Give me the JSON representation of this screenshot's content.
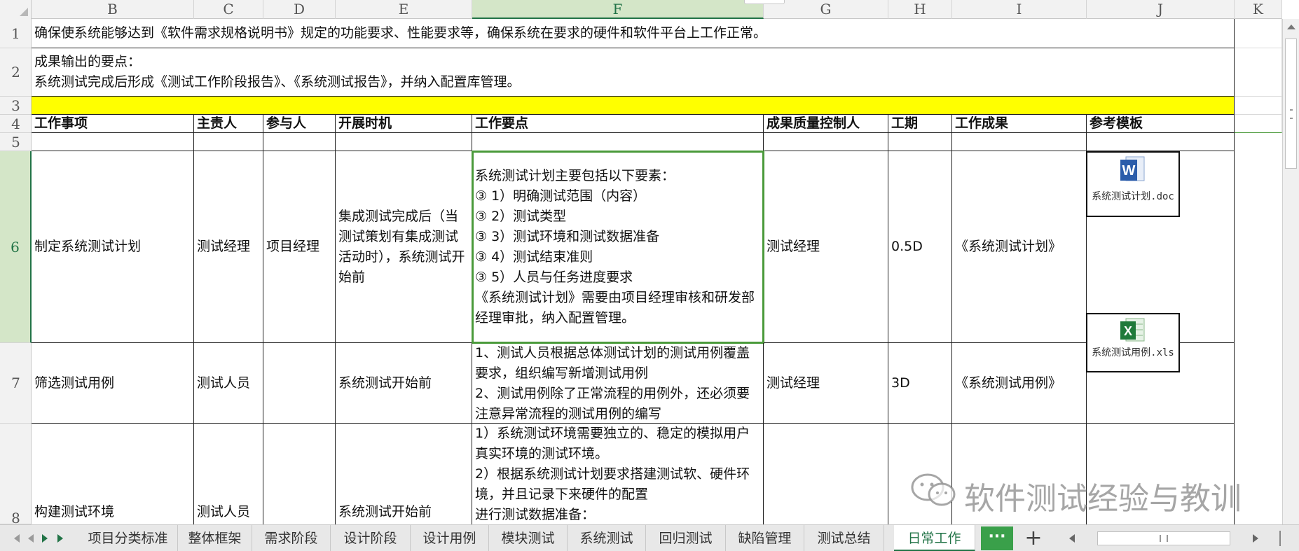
{
  "column_headers": [
    "B",
    "C",
    "D",
    "E",
    "F",
    "G",
    "H",
    "I",
    "J",
    "K"
  ],
  "row_headers": [
    "1",
    "2",
    "3",
    "4",
    "5",
    "6",
    "7",
    "8"
  ],
  "rows": {
    "r1": "确保使系统能够达到《软件需求规格说明书》规定的功能要求、性能要求等，确保系统在要求的硬件和软件平台上工作正常。",
    "r2": "成果输出的要点：\n系统测试完成后形成《测试工作阶段报告》、《系统测试报告》，并纳入配置库管理。"
  },
  "table_headers": [
    "工作事项",
    "主责人",
    "参与人",
    "开展时机",
    "工作要点",
    "成果质量控制人",
    "工期",
    "工作成果",
    "参考模板"
  ],
  "data_rows": [
    {
      "item": "制定系统测试计划",
      "owner": "测试经理",
      "participant": "项目经理",
      "timing": "集成测试完成后（当测试策划有集成测试活动时），系统测试开始前",
      "points": " 系统测试计划主要包括以下要素：\n③ 1）明确测试范围（内容）\n③ 2）测试类型\n③ 3）测试环境和测试数据准备\n③ 4）测试结束准则\n③ 5）人员与任务进度要求\n《系统测试计划》需要由项目经理审核和研发部经理审批，纳入配置管理。",
      "qc": "测试经理",
      "duration": "0.5D",
      "result": "《系统测试计划》",
      "template_file": "系统测试计划.doc"
    },
    {
      "item": "筛选测试用例",
      "owner": "测试人员",
      "participant": "",
      "timing": "系统测试开始前",
      "points": "1、测试人员根据总体测试计划的测试用例覆盖要求，组织编写新增测试用例\n2、测试用例除了正常流程的用例外，还必须要注意异常流程的测试用例的编写",
      "qc": "测试经理",
      "duration": "3D",
      "result": "《系统测试用例》",
      "template_file": "系统测试用例.xls"
    },
    {
      "item": "构建测试环境",
      "owner": "测试人员",
      "participant": "",
      "timing": "系统测试开始前",
      "points": "1）系统测试环境需要独立的、稳定的模拟用户真实环境的测试环境。\n2）根据系统测试计划要求搭建测试软、硬件环境，并且记录下来硬件的配置\n进行测试数据准备：",
      "qc": "",
      "duration": "",
      "result": "",
      "template_file": ""
    }
  ],
  "sheet_tabs": [
    "项目分类标准",
    "整体框架",
    "需求阶段",
    "设计阶段",
    "设计用例",
    "模块测试",
    "系统测试",
    "回归测试",
    "缺陷管理",
    "测试总结",
    "日常工作"
  ],
  "active_tab": "日常工作",
  "more_tabs_label": "···",
  "add_tab_label": "+",
  "watermark": "软件测试经验与教训",
  "colors": {
    "accent": "#217346",
    "yellow_row": "#ffff00",
    "selection": "#4a9a3a"
  }
}
